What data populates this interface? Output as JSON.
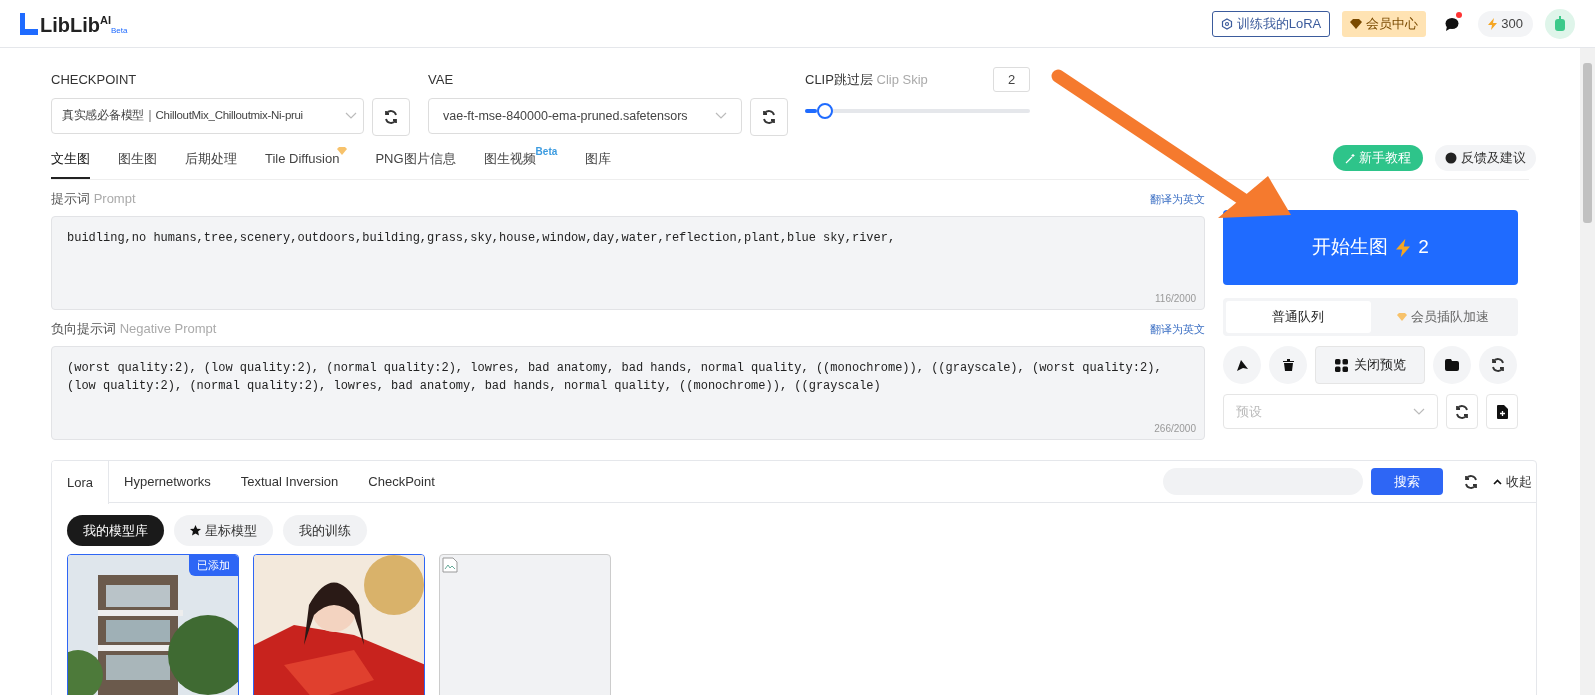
{
  "header": {
    "logo": "LibLib",
    "logo_sup": "AI",
    "logo_badge": "Beta",
    "train_button": "训练我的LoRA",
    "vip_button": "会员中心",
    "has_notification": true,
    "points": "300"
  },
  "model_settings": {
    "checkpoint_label": "CHECKPOINT",
    "checkpoint_value": "真实感必备模型｜ChilloutMix_Chilloutmix-Ni-prui",
    "vae_label": "VAE",
    "vae_value": "vae-ft-mse-840000-ema-pruned.safetensors",
    "clip_label": "CLIP跳过层",
    "clip_label_en": "Clip Skip",
    "clip_value": "2",
    "clip_slider": {
      "level": 0.09
    }
  },
  "tabs": [
    {
      "label": "文生图",
      "selected": true,
      "kind": "plain"
    },
    {
      "label": "图生图",
      "selected": false,
      "kind": "plain"
    },
    {
      "label": "后期处理",
      "selected": false,
      "kind": "plain"
    },
    {
      "label": "Tile Diffusion",
      "selected": false,
      "kind": "gem"
    },
    {
      "label": "PNG图片信息",
      "selected": false,
      "kind": "plain"
    },
    {
      "label": "图生视频",
      "selected": false,
      "kind": "beta",
      "badge": "Beta"
    },
    {
      "label": "图库",
      "selected": false,
      "kind": "plain"
    }
  ],
  "help_buttons": {
    "tutorial": "新手教程",
    "feedback": "反馈及建议"
  },
  "prompts": [
    {
      "label": "提示词",
      "label_en": "Prompt",
      "translate": "翻译为英文",
      "text": "buidling,no humans,tree,scenery,outdoors,building,grass,sky,house,window,day,water,reflection,plant,blue sky,river,",
      "count": "116/2000"
    },
    {
      "label": "负向提示词",
      "label_en": "Negative Prompt",
      "translate": "翻译为英文",
      "text": "(worst quality:2), (low quality:2), (normal quality:2), lowres, bad anatomy, bad hands, normal quality, ((monochrome)), ((grayscale), (worst quality:2), (low quality:2), (normal quality:2), lowres, bad anatomy, bad hands, normal quality, ((monochrome)), ((grayscale)",
      "count": "266/2000"
    }
  ],
  "generate": {
    "label": "开始生图",
    "cost": "2"
  },
  "queue_tabs": [
    {
      "label": "普通队列",
      "selected": true,
      "kind": "plain"
    },
    {
      "label": "会员插队加速",
      "selected": false,
      "kind": "vip"
    }
  ],
  "preview_button": "关闭预览",
  "preset": {
    "placeholder": "预设"
  },
  "lora_panel": {
    "tabs": [
      {
        "label": "Lora",
        "selected": true
      },
      {
        "label": "Hypernetworks",
        "selected": false
      },
      {
        "label": "Textual Inversion",
        "selected": false
      },
      {
        "label": "CheckPoint",
        "selected": false
      }
    ],
    "search_button": "搜索",
    "collapse": "收起",
    "filters": [
      {
        "label": "我的模型库",
        "selected": true,
        "kind": "plain"
      },
      {
        "label": "星标模型",
        "selected": false,
        "kind": "star"
      },
      {
        "label": "我的训练",
        "selected": false,
        "kind": "plain"
      }
    ],
    "cards": [
      {
        "kind": "building",
        "badge": "已添加"
      },
      {
        "kind": "figure"
      },
      {
        "kind": "broken"
      }
    ]
  }
}
